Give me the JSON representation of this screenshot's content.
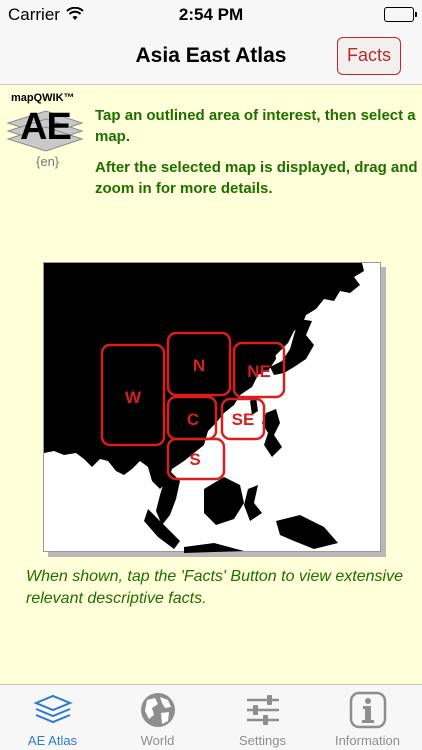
{
  "status_bar": {
    "carrier": "Carrier",
    "time": "2:54 PM"
  },
  "nav": {
    "title": "Asia East Atlas",
    "facts_button": "Facts"
  },
  "logo": {
    "trademark": "mapQWIK™",
    "letters": "AE",
    "language": "{en}"
  },
  "instructions": {
    "line1": "Tap an outlined area of interest, then select a map.",
    "line2": "After the selected map is displayed, drag and zoom in for more details."
  },
  "map": {
    "regions": [
      {
        "label": "W"
      },
      {
        "label": "N"
      },
      {
        "label": "NE"
      },
      {
        "label": "C"
      },
      {
        "label": "SE"
      },
      {
        "label": "S"
      }
    ]
  },
  "facts_hint": "When shown, tap the 'Facts' Button to view extensive relevant descriptive facts.",
  "tabs": [
    {
      "label": "AE Atlas",
      "icon": "layers-icon",
      "active": true
    },
    {
      "label": "World",
      "icon": "globe-icon",
      "active": false
    },
    {
      "label": "Settings",
      "icon": "sliders-icon",
      "active": false
    },
    {
      "label": "Information",
      "icon": "info-icon",
      "active": false
    }
  ],
  "colors": {
    "accent": "#b52a2a",
    "text_green": "#1f6e00",
    "tab_active": "#2a7ad0",
    "background": "#ffffd9"
  }
}
